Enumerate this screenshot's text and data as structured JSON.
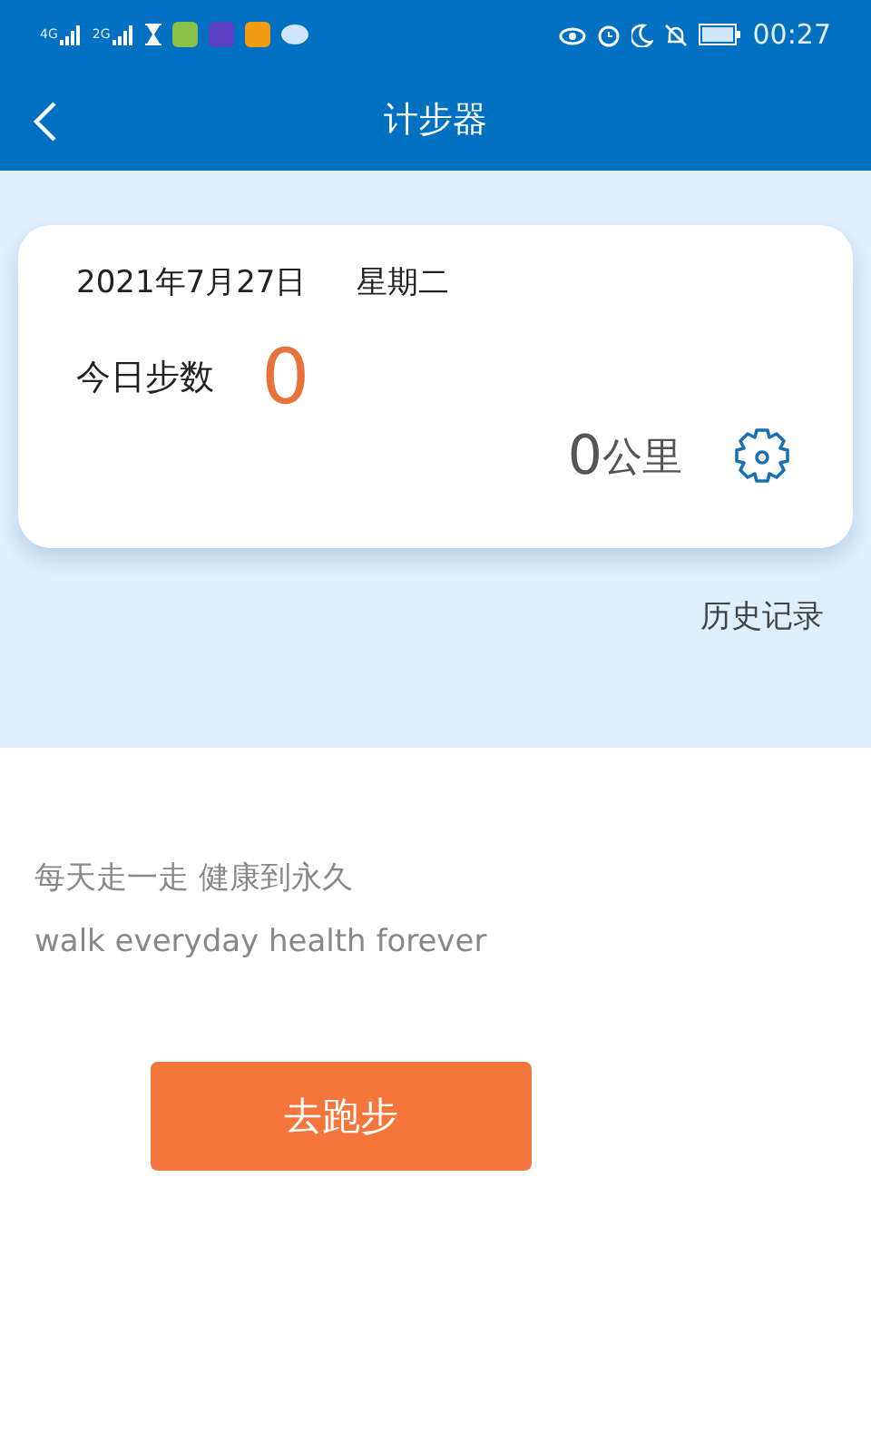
{
  "status_bar": {
    "networks": [
      "4G",
      "2G"
    ],
    "time": "00:27"
  },
  "header": {
    "title": "计步器"
  },
  "card": {
    "date": "2021年7月27日",
    "weekday": "星期二",
    "steps_label": "今日步数",
    "steps": "0",
    "distance": "0",
    "distance_unit": "公里"
  },
  "history_link": "历史记录",
  "slogan": {
    "chinese": "每天走一走 健康到永久",
    "english": "walk everyday health forever"
  },
  "run_button": "去跑步"
}
